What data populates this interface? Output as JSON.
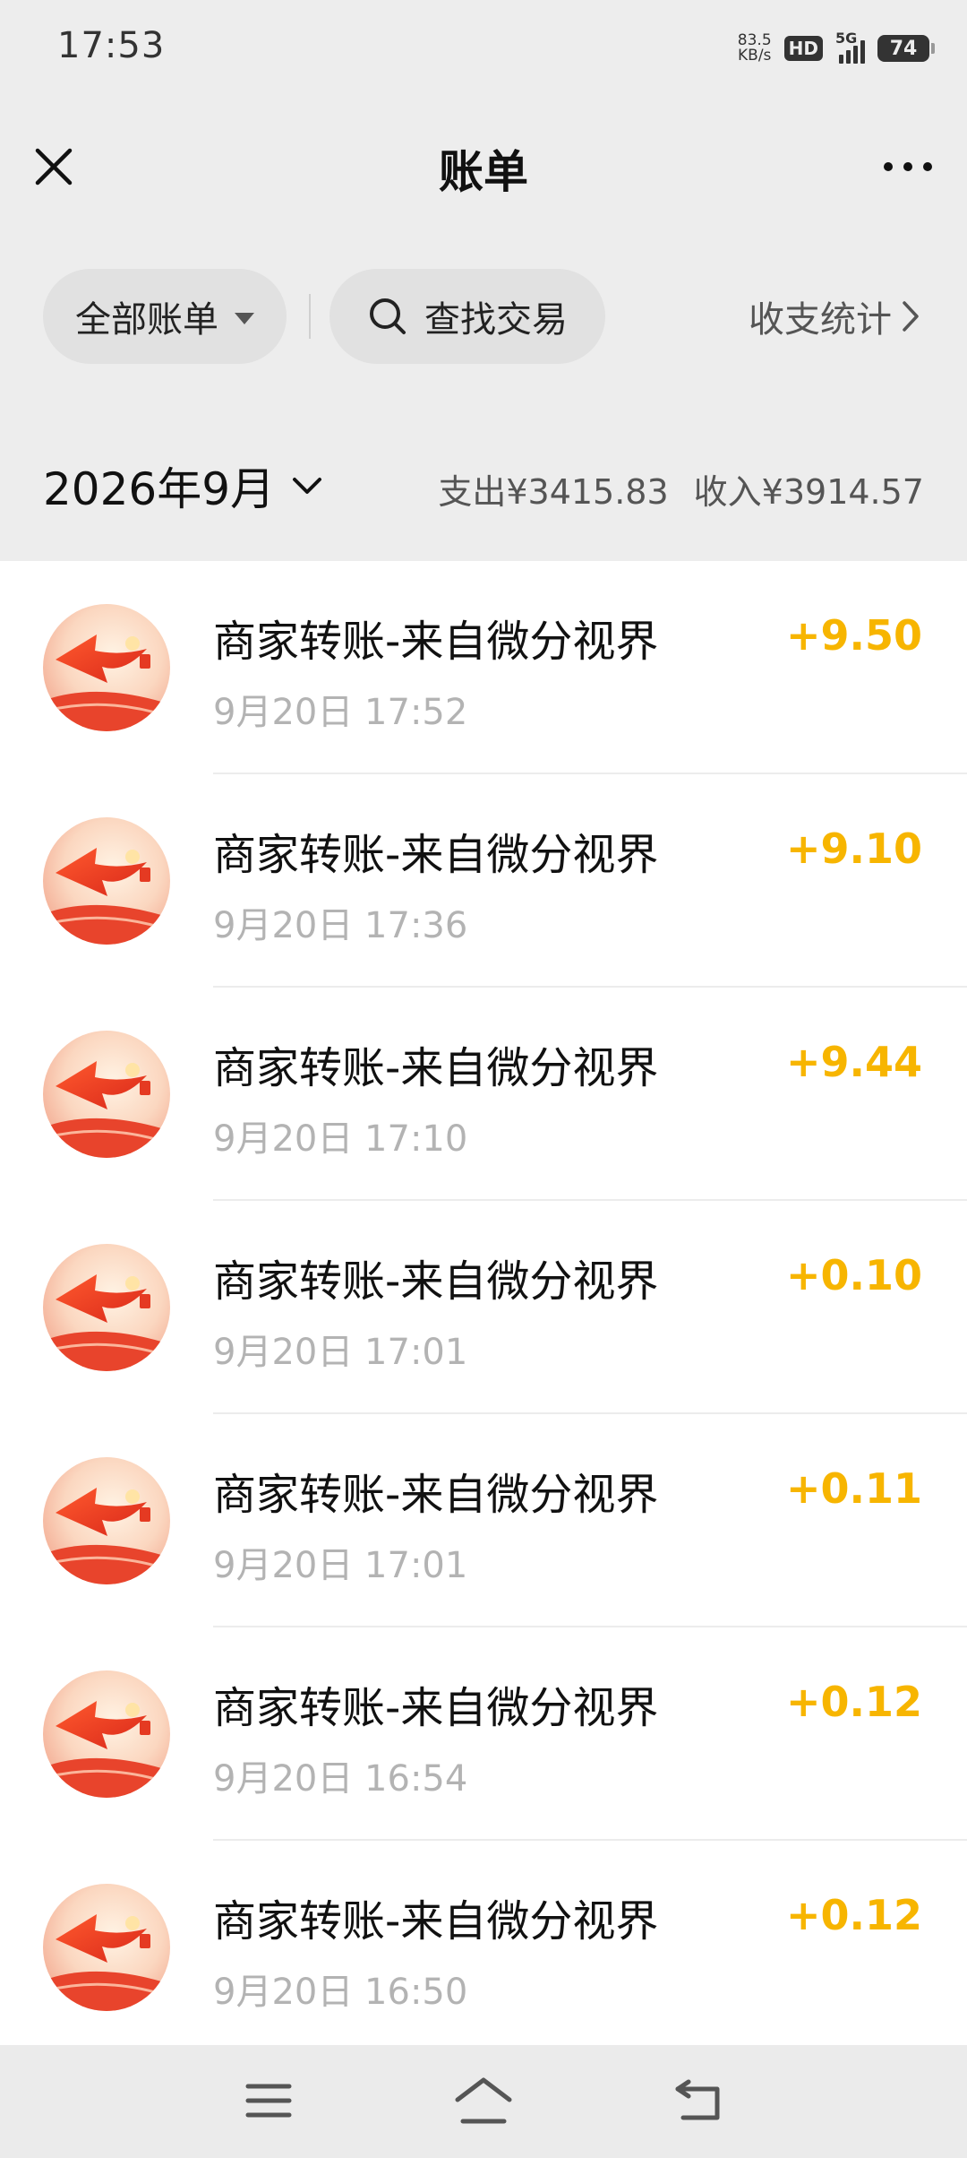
{
  "status_bar": {
    "time": "17:53",
    "net_speed_value": "83.5",
    "net_speed_unit": "KB/s",
    "hd": "HD",
    "network": "5G",
    "battery": "74"
  },
  "header": {
    "title": "账单",
    "close_icon": "close-icon",
    "more_icon": "more-icon"
  },
  "filters": {
    "all_bills": "全部账单",
    "search": "查找交易",
    "stats": "收支统计"
  },
  "month": {
    "label": "2026年9月",
    "expense": "支出¥3415.83",
    "income": "收入¥3914.57"
  },
  "transactions": [
    {
      "title": "商家转账-来自微分视界",
      "time": "9月20日 17:52",
      "amount": "+9.50"
    },
    {
      "title": "商家转账-来自微分视界",
      "time": "9月20日 17:36",
      "amount": "+9.10"
    },
    {
      "title": "商家转账-来自微分视界",
      "time": "9月20日 17:10",
      "amount": "+9.44"
    },
    {
      "title": "商家转账-来自微分视界",
      "time": "9月20日 17:01",
      "amount": "+0.10"
    },
    {
      "title": "商家转账-来自微分视界",
      "time": "9月20日 17:01",
      "amount": "+0.11"
    },
    {
      "title": "商家转账-来自微分视界",
      "time": "9月20日 16:54",
      "amount": "+0.12"
    },
    {
      "title": "商家转账-来自微分视界",
      "time": "9月20日 16:50",
      "amount": "+0.12"
    }
  ],
  "colors": {
    "income_amount": "#f7b500",
    "background": "#ededed"
  },
  "nav": {
    "menu_icon": "menu-icon",
    "home_icon": "home-icon",
    "back_icon": "back-icon"
  }
}
